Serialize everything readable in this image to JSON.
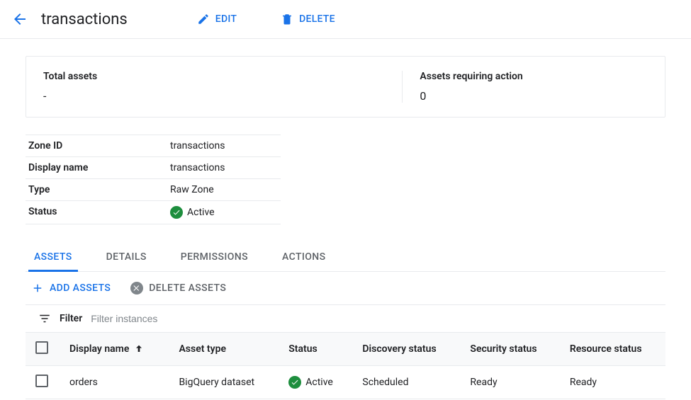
{
  "header": {
    "title": "transactions",
    "edit_label": "EDIT",
    "delete_label": "DELETE"
  },
  "summary": {
    "total_label": "Total assets",
    "total_value": "-",
    "action_label": "Assets requiring action",
    "action_value": "0"
  },
  "meta": {
    "zone_id_label": "Zone ID",
    "zone_id_value": "transactions",
    "display_name_label": "Display name",
    "display_name_value": "transactions",
    "type_label": "Type",
    "type_value": "Raw Zone",
    "status_label": "Status",
    "status_value": "Active"
  },
  "tabs": {
    "assets": "ASSETS",
    "details": "DETAILS",
    "permissions": "PERMISSIONS",
    "actions": "ACTIONS"
  },
  "toolbar": {
    "add_label": "ADD ASSETS",
    "delete_label": "DELETE ASSETS"
  },
  "filter": {
    "label": "Filter",
    "placeholder": "Filter instances"
  },
  "table": {
    "cols": {
      "display_name": "Display name",
      "asset_type": "Asset type",
      "status": "Status",
      "discovery_status": "Discovery status",
      "security_status": "Security status",
      "resource_status": "Resource status"
    },
    "rows": [
      {
        "display_name": "orders",
        "asset_type": "BigQuery dataset",
        "status": "Active",
        "discovery_status": "Scheduled",
        "security_status": "Ready",
        "resource_status": "Ready"
      }
    ]
  }
}
